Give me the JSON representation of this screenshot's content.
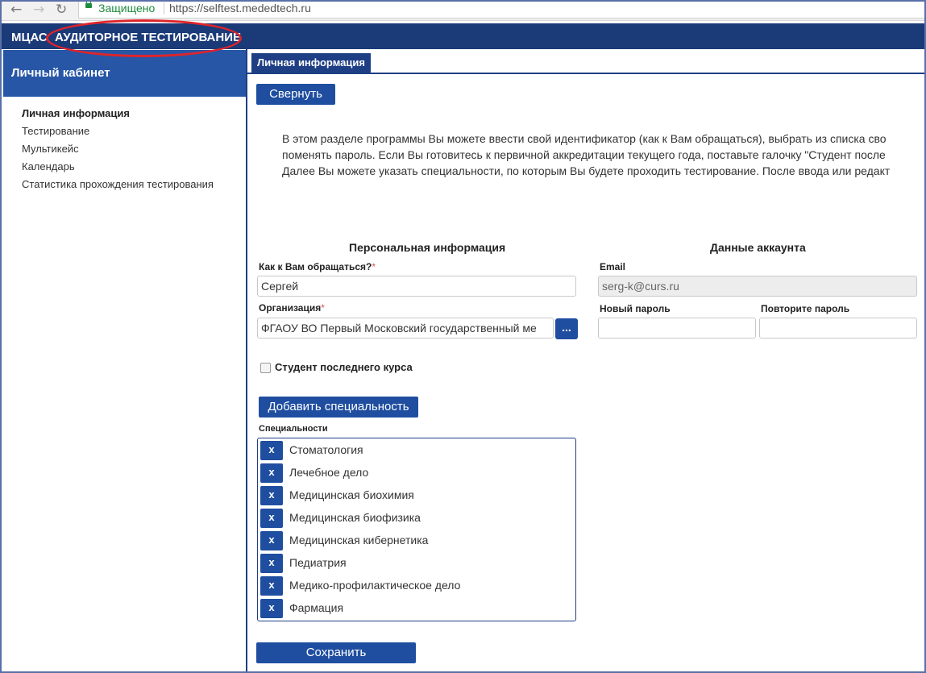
{
  "browser": {
    "secure_label": "Защищено",
    "url": "https://selftest.mededtech.ru"
  },
  "header": {
    "brand": "МЦАС",
    "title": "АУДИТОРНОЕ ТЕСТИРОВАНИЕ",
    "annotation_color": "#e0242a"
  },
  "sidebar": {
    "title": "Личный кабинет",
    "items": [
      {
        "label": "Личная информация"
      },
      {
        "label": "Тестирование"
      },
      {
        "label": "Мультикейс"
      },
      {
        "label": "Календарь"
      },
      {
        "label": "Статистика прохождения тестирования"
      }
    ]
  },
  "main": {
    "tab": "Личная информация",
    "collapse_label": "Свернуть",
    "intro": [
      "В этом разделе программы Вы можете ввести свой идентификатор (как к Вам обращаться), выбрать из списка сво",
      "поменять пароль. Если Вы готовитесь к первичной аккредитации текущего года, поставьте галочку \"Студент после",
      "Далее Вы можете указать специальности, по которым Вы будете проходить тестирование. После ввода или редакт"
    ]
  },
  "personal": {
    "title": "Персональная информация",
    "name_label": "Как к Вам обращаться?",
    "name_value": "Сергей",
    "org_label": "Организация",
    "org_value": "ФГАОУ ВО Первый Московский государственный ме",
    "org_button": "...",
    "required_mark": "*"
  },
  "account": {
    "title": "Данные аккаунта",
    "email_label": "Email",
    "email_value": "serg-k@curs.ru",
    "password_label": "Новый пароль",
    "repeat_label": "Повторите пароль"
  },
  "student": {
    "label": "Студент последнего курса",
    "checked": false
  },
  "specialties": {
    "add_label": "Добавить специальность",
    "list_label": "Специальности",
    "remove_glyph": "x",
    "items": [
      {
        "name": "Стоматология"
      },
      {
        "name": "Лечебное дело"
      },
      {
        "name": "Медицинская биохимия"
      },
      {
        "name": "Медицинская биофизика"
      },
      {
        "name": "Медицинская кибернетика"
      },
      {
        "name": "Педиатрия"
      },
      {
        "name": "Медико-профилактическое дело"
      },
      {
        "name": "Фармация"
      }
    ]
  },
  "save_label": "Сохранить",
  "colors": {
    "header": "#1b3a78",
    "sidebar_head": "#2756a6",
    "button": "#1f4ea0",
    "secure": "#1e8b3e"
  }
}
